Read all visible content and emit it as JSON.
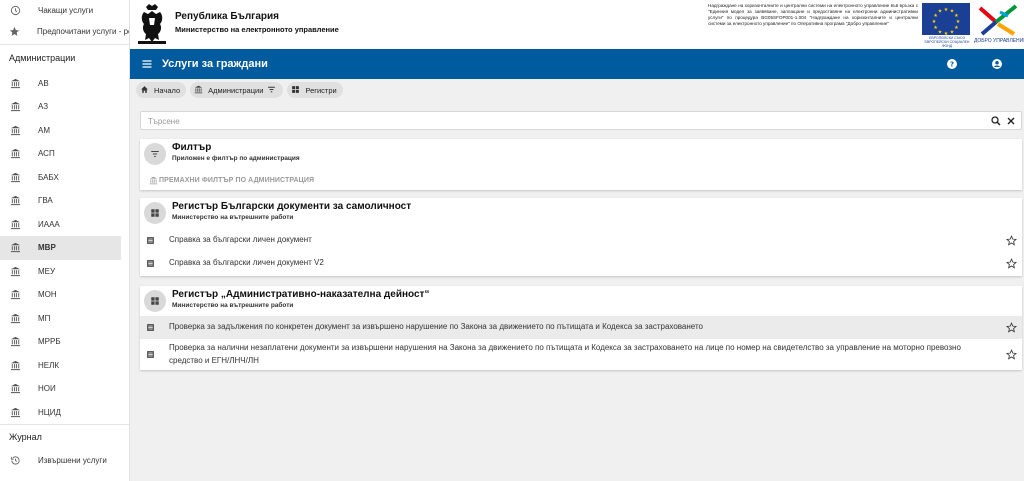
{
  "sidebar": {
    "top_items": [
      {
        "label": "Чакащи услуги",
        "icon": "clock-icon"
      },
      {
        "label": "Предпочитани услуги - ре",
        "icon": "star-icon"
      }
    ],
    "section_admin": "Администрации",
    "admin_items": [
      {
        "label": "АВ"
      },
      {
        "label": "АЗ"
      },
      {
        "label": "АМ"
      },
      {
        "label": "АСП"
      },
      {
        "label": "БАБХ"
      },
      {
        "label": "ГВА"
      },
      {
        "label": "ИААА"
      },
      {
        "label": "МВР",
        "active": true
      },
      {
        "label": "МЕУ"
      },
      {
        "label": "МОН"
      },
      {
        "label": "МП"
      },
      {
        "label": "МРРБ"
      },
      {
        "label": "НЕЛК"
      },
      {
        "label": "НОИ"
      },
      {
        "label": "НЦИД"
      }
    ],
    "section_journal": "Журнал",
    "journal_items": [
      {
        "label": "Извършени услуги",
        "icon": "history-icon"
      }
    ]
  },
  "banner": {
    "title": "Република България",
    "subtitle": "Министерство на електронното управление",
    "eu_text": "Надграждане на хоризонталните и централни системи на електронното управление във връзка с \"Единния модел за заявяване, заплащане и предоставяне на електронни административни услуги\" по процедура BG05SFOP001-1.004 \"Надграждане на хоризонталните и централни системи за електронното управление\" по Оперативна програма \"Добро управление\"",
    "eu_flag_label": "ЕВРОПЕЙСКИ СЪЮЗ ЕВРОПЕЙСКИ СОЦИАЛЕН ФОНД",
    "dobro_label": "ДОБРО УПРАВЛЕНИЕ"
  },
  "appbar": {
    "title": "Услуги за граждани",
    "color": "#005a9e"
  },
  "breadcrumbs": [
    {
      "label": "Начало",
      "icon": "home-icon"
    },
    {
      "label": "Администрации",
      "icon": "institution-icon"
    },
    {
      "label": "Регистри",
      "icon": "grid-icon"
    }
  ],
  "search": {
    "placeholder": "Търсене",
    "value": ""
  },
  "filter_card": {
    "title": "Филтър",
    "subtitle": "Приложен е филтър по администрация",
    "remove_label": "ПРЕМАХНИ ФИЛТЪР ПО АДМИНИСТРАЦИЯ"
  },
  "registers": [
    {
      "title": "Регистър Български документи за самоличност",
      "subtitle": "Министерство на вътрешните работи",
      "services": [
        {
          "label": "Справка за български личен документ"
        },
        {
          "label": "Справка за български личен документ V2"
        }
      ]
    },
    {
      "title": "Регистър „Административно-наказателна дейност“",
      "subtitle": "Министерство на вътрешните работи",
      "services": [
        {
          "label": "Проверка за задължения по конкретен документ за извършено нарушение по Закона за движението по пътищата и Кодекса за застраховането"
        },
        {
          "label": "Проверка за налични незаплатени документи за извършени нарушения на Закона за движението по пътищата и Кодекса за застраховането на лице по номер на свидетелство за управление на моторно превозно средство и ЕГН/ЛНЧ/ЛН"
        }
      ]
    }
  ]
}
